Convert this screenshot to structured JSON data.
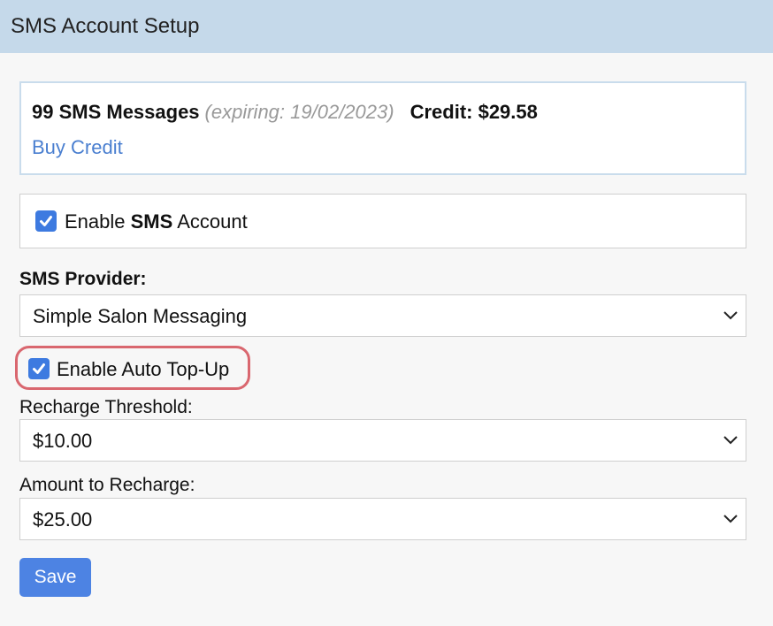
{
  "header": {
    "title": "SMS Account Setup"
  },
  "credit": {
    "messages": "99 SMS Messages",
    "expiry": "(expiring: 19/02/2023)",
    "balance": "Credit: $29.58",
    "buy_link": "Buy Credit"
  },
  "enable_sms": {
    "checked": true,
    "label_prefix": "Enable ",
    "label_bold": "SMS",
    "label_suffix": " Account"
  },
  "provider": {
    "label": "SMS Provider:",
    "value": "Simple Salon Messaging"
  },
  "auto_topup": {
    "checked": true,
    "label": "Enable Auto Top-Up"
  },
  "threshold": {
    "label": "Recharge Threshold:",
    "value": "$10.00"
  },
  "recharge_amount": {
    "label": "Amount to Recharge:",
    "value": "$25.00"
  },
  "actions": {
    "save_label": "Save"
  },
  "colors": {
    "header_bg": "#c5d9ea",
    "accent": "#4d83e3",
    "link": "#4a7fd0",
    "highlight": "#d9676f"
  },
  "icons": {
    "checkbox": "checkmark-icon",
    "select": "chevron-down-icon"
  }
}
